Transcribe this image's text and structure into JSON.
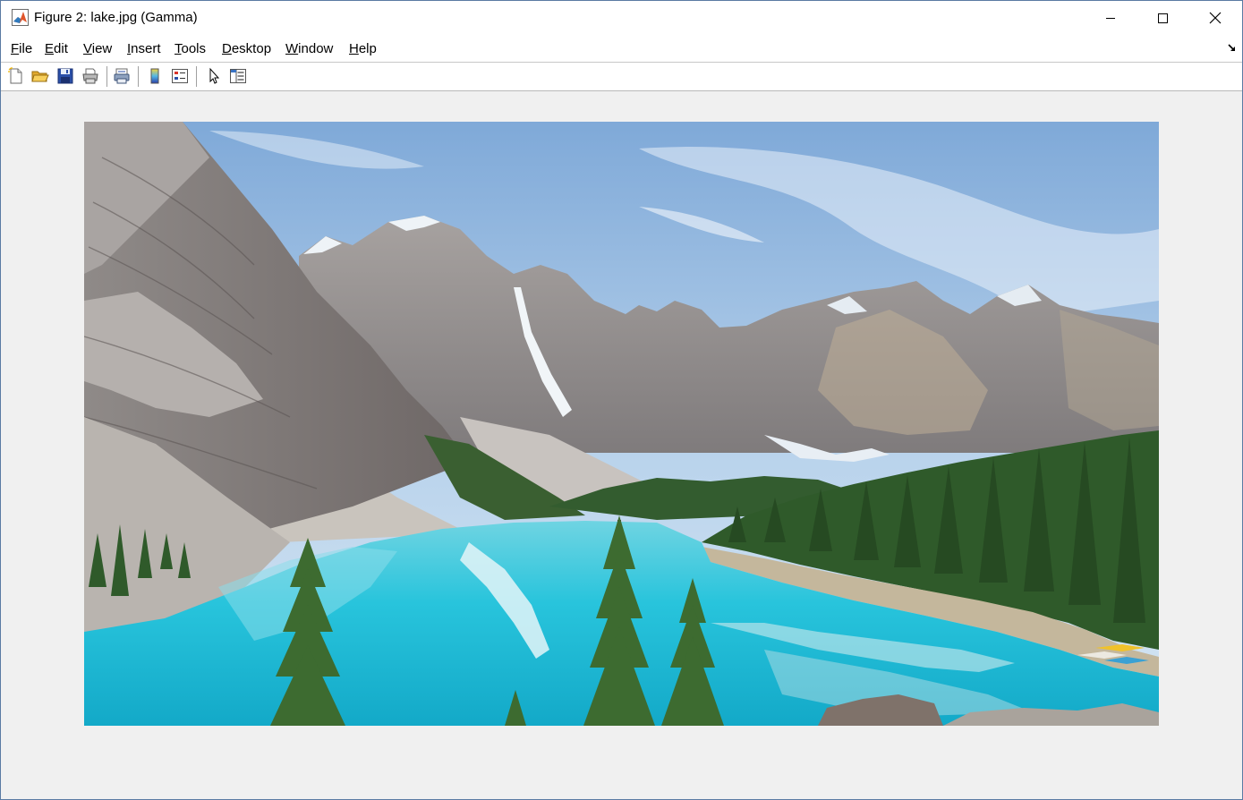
{
  "window": {
    "title": "Figure 2: lake.jpg (Gamma)",
    "app_icon": "matlab-icon",
    "controls": {
      "minimize_icon": "minimize-icon",
      "maximize_icon": "maximize-icon",
      "close_icon": "close-icon"
    }
  },
  "menubar": {
    "items": [
      {
        "label": "File",
        "accel": "F",
        "rest": "ile"
      },
      {
        "label": "Edit",
        "accel": "E",
        "rest": "dit"
      },
      {
        "label": "View",
        "accel": "V",
        "rest": "iew"
      },
      {
        "label": "Insert",
        "accel": "I",
        "rest": "nsert"
      },
      {
        "label": "Tools",
        "accel": "T",
        "rest": "ools"
      },
      {
        "label": "Desktop",
        "accel": "D",
        "rest": "esktop"
      },
      {
        "label": "Window",
        "accel": "W",
        "rest": "indow"
      },
      {
        "label": "Help",
        "accel": "H",
        "rest": "elp"
      }
    ],
    "dock_icon": "dock-arrow-icon"
  },
  "toolbar": {
    "buttons": [
      {
        "name": "new-figure",
        "icon": "new-file-icon"
      },
      {
        "name": "open-file",
        "icon": "folder-open-icon"
      },
      {
        "name": "save-figure",
        "icon": "save-icon"
      },
      {
        "name": "print-figure",
        "icon": "printer-icon"
      },
      {
        "name": "link-plot",
        "icon": "link-plot-icon"
      },
      {
        "name": "insert-colorbar",
        "icon": "colorbar-icon"
      },
      {
        "name": "insert-legend",
        "icon": "legend-icon"
      },
      {
        "name": "edit-plot",
        "icon": "pointer-icon"
      },
      {
        "name": "property-inspector",
        "icon": "property-inspector-icon"
      }
    ]
  },
  "figure": {
    "image_name": "lake.jpg",
    "image_description_icon": "mountain-lake-photo",
    "colors": {
      "sky_top": "#7fa9d8",
      "sky_bottom": "#d6e6f3",
      "lake": "#28c4dc",
      "forest": "#2f5a2a",
      "rock": "#9a9a9c"
    }
  }
}
